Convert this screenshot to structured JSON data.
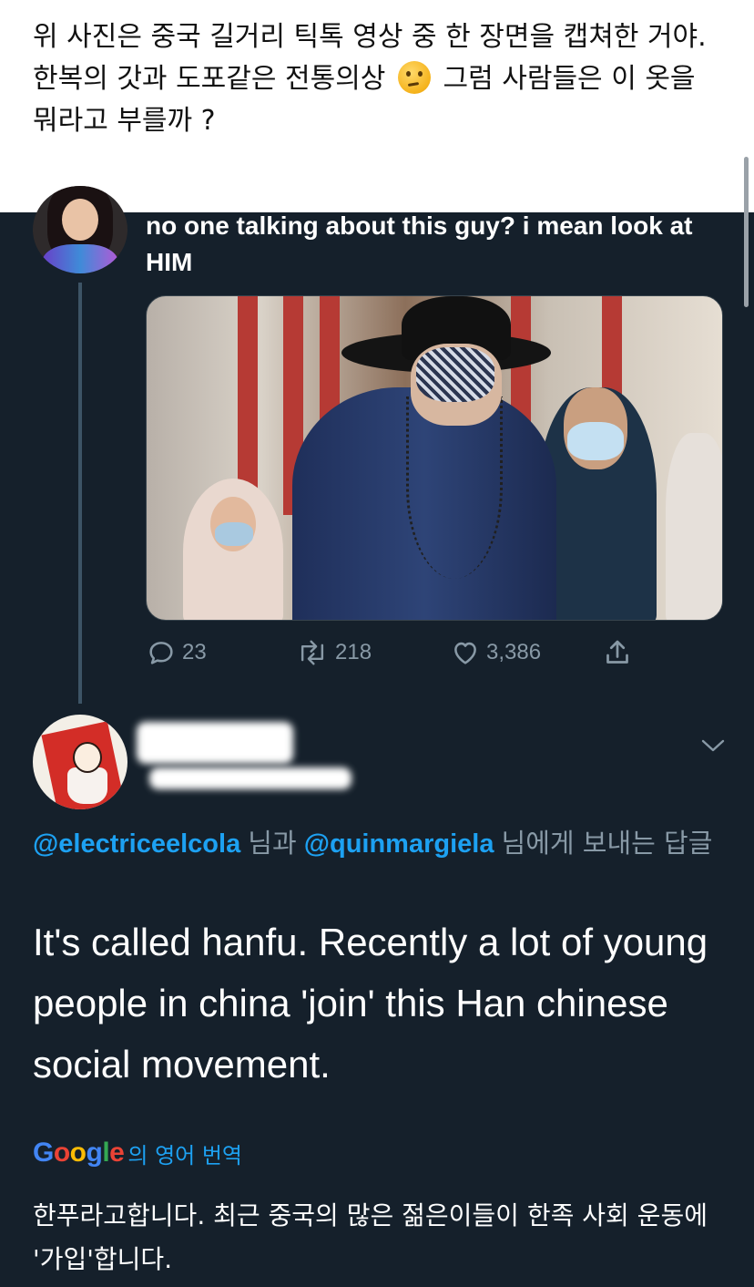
{
  "caption": {
    "line1": "위 사진은 중국 길거리 틱톡 영상 중 한 장면을 캡쳐한 거야.",
    "line2_before_emoji": "한복의 갓과 도포같은 전통의상",
    "emoji": "thinking-face-emoji",
    "line2_after_emoji": "그럼 사람들은 이 옷을",
    "line3": "뭐라고 부를까 ?"
  },
  "original_tweet": {
    "text": "no one talking about this guy? i mean look at HIM",
    "media": "photo-street-hanfu",
    "stats": {
      "replies": "23",
      "retweets": "218",
      "likes": "3,386"
    }
  },
  "reply_tweet": {
    "reply_to": {
      "mention1": "@electriceelcola",
      "and": "님과",
      "mention2": "@quinmargiela",
      "suffix": "님에게 보내는 답글"
    },
    "text": "It's called hanfu. Recently a lot of young people in china 'join' this Han chinese social movement.",
    "translate_by": "Google",
    "translate_label": "의 영어 번역",
    "translation": "한푸라고합니다. 최근 중국의 많은 젊은이들이 한족 사회 운동에 '가입'합니다."
  },
  "colors": {
    "background": "#15202b",
    "accent": "#1da1f2",
    "muted": "#8899a6"
  }
}
